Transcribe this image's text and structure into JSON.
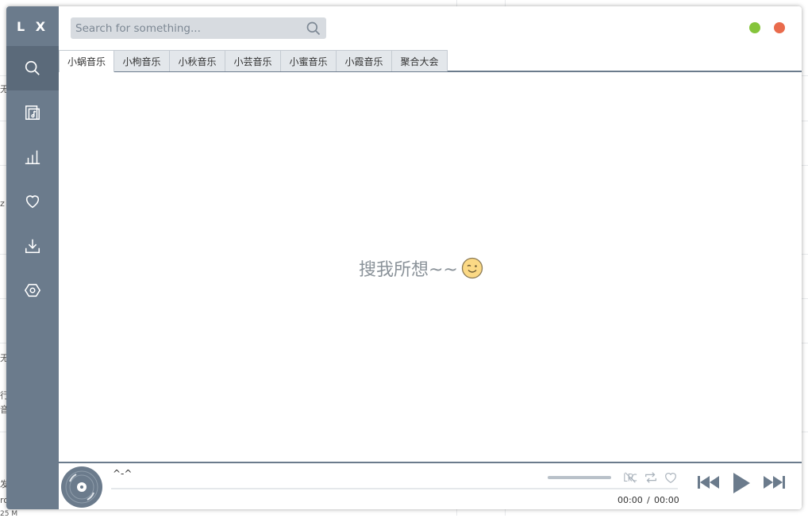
{
  "app": {
    "logo": "L X"
  },
  "sidebar": {
    "items": [
      {
        "name": "search",
        "icon": "search-icon",
        "active": true
      },
      {
        "name": "playlist",
        "icon": "music-file-icon",
        "active": false
      },
      {
        "name": "leaderboard",
        "icon": "bar-chart-icon",
        "active": false
      },
      {
        "name": "favorites",
        "icon": "heart-icon",
        "active": false
      },
      {
        "name": "download",
        "icon": "download-icon",
        "active": false
      },
      {
        "name": "settings",
        "icon": "hexagon-settings-icon",
        "active": false
      }
    ]
  },
  "search": {
    "placeholder": "Search for something...",
    "value": ""
  },
  "window_controls": {
    "minimize_color": "#85c43b",
    "close_color": "#e96b4c"
  },
  "tabs": [
    {
      "label": "小蜗音乐",
      "active": true
    },
    {
      "label": "小枸音乐",
      "active": false
    },
    {
      "label": "小秋音乐",
      "active": false
    },
    {
      "label": "小芸音乐",
      "active": false
    },
    {
      "label": "小蜜音乐",
      "active": false
    },
    {
      "label": "小霞音乐",
      "active": false
    },
    {
      "label": "聚合大会",
      "active": false
    }
  ],
  "empty_state": {
    "message": "搜我所想~~",
    "icon": "wink-emoji-icon"
  },
  "player": {
    "title": "^-^",
    "current_time": "00:00",
    "separator": "/",
    "total_time": "00:00",
    "lyric_toggle_icon": "lrc-icon",
    "repeat_icon": "repeat-icon",
    "favorite_icon": "heart-outline-icon"
  },
  "background": {
    "fragments": [
      "无",
      "z",
      "无",
      "行",
      "音",
      "发",
      "ro",
      "25 M"
    ]
  },
  "colors": {
    "sidebar": "#6b7b8c",
    "sidebar_active": "#5b6a7a",
    "accent": "#6b7b8c"
  }
}
